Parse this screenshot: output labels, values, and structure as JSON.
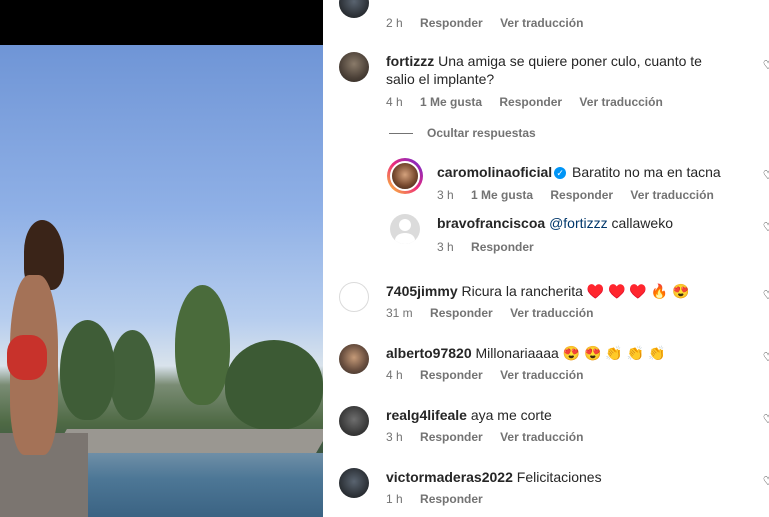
{
  "comments_top": {
    "time": "2 h",
    "reply_label": "Responder",
    "translate_label": "Ver traducción"
  },
  "comments": [
    {
      "username": "fortizzz",
      "text": "Una amiga se quiere poner culo, cuanto te salio el implante?",
      "time": "4 h",
      "likes": "1 Me gusta",
      "reply_label": "Responder",
      "translate_label": "Ver traducción"
    },
    {
      "username": "7405jimmy",
      "text": "Ricura la rancherita ♥️ ♥️ ♥️ 🔥 😍",
      "time": "31 m",
      "reply_label": "Responder",
      "translate_label": "Ver traducción"
    },
    {
      "username": "alberto97820",
      "text": "Millonariaaaa 😍 😍 👏 👏 👏",
      "time": "4 h",
      "reply_label": "Responder",
      "translate_label": "Ver traducción"
    },
    {
      "username": "realg4lifeale",
      "text": "aya me corte",
      "time": "3 h",
      "reply_label": "Responder",
      "translate_label": "Ver traducción"
    },
    {
      "username": "victormaderas2022",
      "text": "Felicitaciones",
      "time": "1 h",
      "reply_label": "Responder"
    }
  ],
  "hide_replies_label": "Ocultar respuestas",
  "replies": [
    {
      "username": "caromolinaoficial",
      "text": "Baratito no ma en tacna",
      "time": "3 h",
      "likes": "1 Me gusta",
      "reply_label": "Responder",
      "translate_label": "Ver traducción"
    },
    {
      "username": "bravofranciscoa",
      "mention": "@fortizzz",
      "text": "callaweko",
      "time": "3 h",
      "reply_label": "Responder"
    }
  ],
  "icons": {
    "heart": "heart-outline-icon",
    "verified": "verified-badge-icon"
  },
  "colors": {
    "meta_text": "#737373",
    "verified_blue": "#0095f6",
    "mention": "#00376b"
  }
}
